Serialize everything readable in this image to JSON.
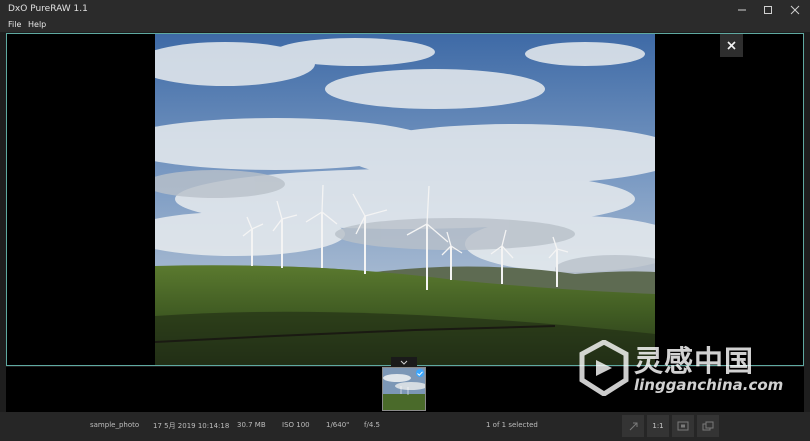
{
  "window": {
    "title": "DxO PureRAW 1.1"
  },
  "menu": {
    "file_label": "File",
    "help_label": "Help"
  },
  "viewer": {
    "image_alt": "Wind turbines on green hills under cloudy sky"
  },
  "thumbnail": {
    "selected": true
  },
  "status": {
    "filename": "sample_photo",
    "date": "17 5月 2019 10:14:18",
    "filesize": "30.7 MB",
    "iso": "ISO 100",
    "shutter": "1/640\"",
    "aperture": "f/4.5",
    "selection": "1 of 1 selected",
    "zoom_label": "1:1"
  },
  "watermark": {
    "cn_text": "灵感中国",
    "url_text": "lingganchina.com"
  },
  "colors": {
    "accent_border": "#5fa9a1",
    "check_blue": "#3aa7ff"
  }
}
